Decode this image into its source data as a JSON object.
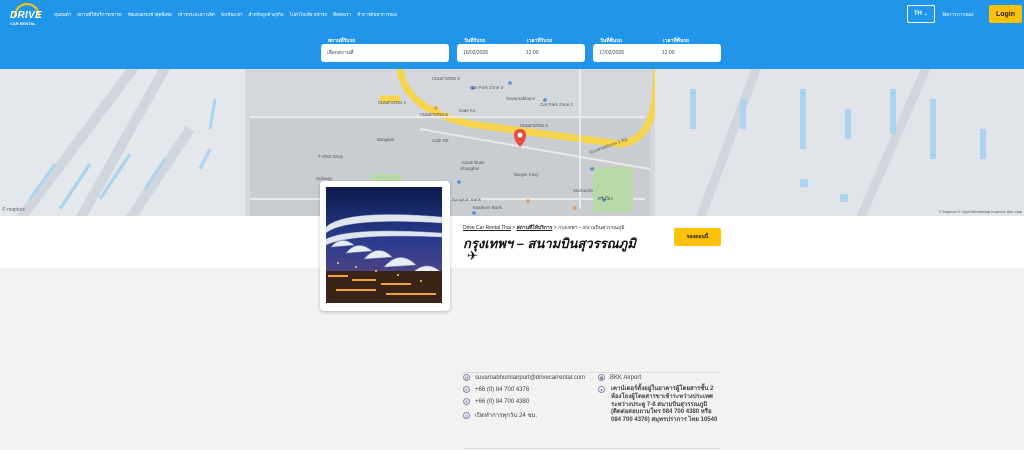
{
  "header": {
    "logo_text": "DRIVE",
    "logo_sub": "CAR RENTAL",
    "nav": [
      "ทุ่นยนต์ฯ",
      "สถานที่ให้บริการเช่ารถ",
      "ข้อเสนอรถเช่าสุดพิเศษ",
      "เช่ารถระยะยาวเลิศ",
      "รถเชียงเชฯ",
      "สำหรับลูกค้าธุรกิจ",
      "ไปท่าไปเที่ยวเช่ารถ",
      "ติดต่อเรา",
      "ทำการค้นหาการจอง"
    ],
    "lang": "TH",
    "manage": "จัดการการจอง",
    "login": "Login"
  },
  "search": {
    "pickup_label": "สถานที่รับรถ",
    "pickup_value": "เลือกสถานที่",
    "pickup_date_label": "วันที่รับรถ",
    "pickup_date": "16/02/2026",
    "pickup_time_label": "เวลาที่รับรถ",
    "pickup_time": "12:00",
    "return_date_label": "วันที่คืนรถ",
    "return_date": "17/02/2026",
    "return_time_label": "เวลาที่คืนรถ",
    "return_time": "12:00"
  },
  "map": {
    "labels": [
      "ถนนสายรอง 5",
      "ถนนสายรอง 6",
      "ถนนสายรอง 4",
      "ถนนสายรอง 6",
      "Suvarnabhumi 1 Rd.",
      "Car Park Zone 2",
      "Car Park Zone 3",
      "Suvarnabhumi",
      "T-Shirt Shop",
      "Kiosk Buds",
      "Bangkok",
      "Gate K1",
      "Cafe D5",
      "Shanghai",
      "Burger King",
      "ร้านกาแฟ",
      "Bangkok Bank",
      "Starbucks",
      "Kasikorn Bank",
      "Subway",
      "ศรีเมือง"
    ],
    "attribution": "© Mapbox © OpenStreetMap Improve this map",
    "logo": "© mapbox"
  },
  "breadcrumb": {
    "home": "Drive Car Rental Thai",
    "section": "สถานที่ให้บริการ",
    "current": "กรุงเทพฯ – สนามบินสุวรรณภูมิ"
  },
  "location": {
    "title": "กรุงเทพฯ – สนามบินสุวรรณภูมิ",
    "cta": "จองตอนนี้"
  },
  "contact": {
    "email": "suvarnabhumiairport@drivecarrental.com",
    "phone1": "+66 (0) 84 700 4376",
    "phone2": "+66 (0) 84 700 4380",
    "hours": "เปิดทำการทุกวัน 24 ชม.",
    "code": "BKK Airport",
    "address": "เคาน์เตอร์ตั้งอยู่ในอาคารผู้โดยสารชั้น 2 ห้องโถงผู้โดยสารขาเข้าระหว่างประเทศ ระหว่างประตู 7-8 สนามบินสุวรรณภูมิ (ติดต่อสอบถามโทร 084 700 4380 หรือ 084 700 4376) สมุทรปราการ ไทย 10540"
  }
}
